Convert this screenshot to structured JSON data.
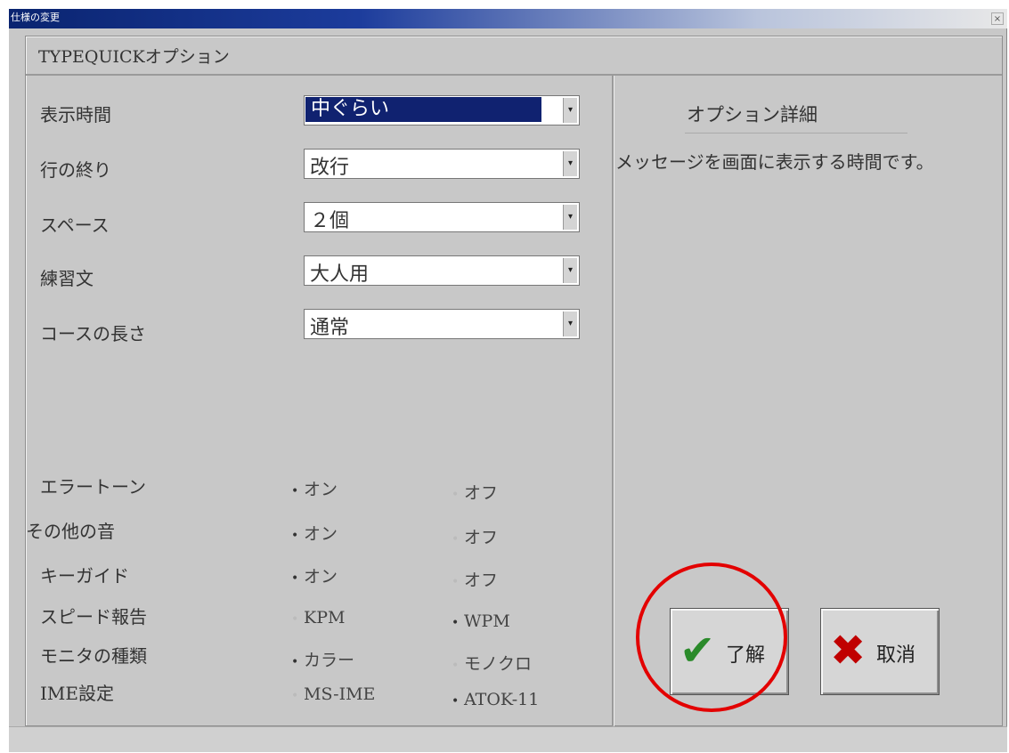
{
  "window": {
    "title": "仕様の変更",
    "close_glyph": "×"
  },
  "group_title": "TYPEQUICKオプション",
  "settings": [
    {
      "label": "表示時間",
      "value": "中ぐらい",
      "selected": true
    },
    {
      "label": "行の終り",
      "value": "改行"
    },
    {
      "label": "スペース",
      "value": "２個"
    },
    {
      "label": "練習文",
      "value": "大人用"
    },
    {
      "label": "コースの長さ",
      "value": "通常"
    }
  ],
  "dropdown_arrow": "▾",
  "toggles": [
    {
      "label": "エラートーン",
      "opt1": "オン",
      "opt2": "オフ",
      "checked": 1
    },
    {
      "label": "その他の音",
      "opt1": "オン",
      "opt2": "オフ",
      "checked": 1
    },
    {
      "label": "キーガイド",
      "opt1": "オン",
      "opt2": "オフ",
      "checked": 1
    },
    {
      "label": "スピード報告",
      "opt1": "KPM",
      "opt2": "WPM",
      "checked": 2
    },
    {
      "label": "モニタの種類",
      "opt1": "カラー",
      "opt2": "モノクロ",
      "checked": 1
    },
    {
      "label": "IME設定",
      "opt1": "MS-IME",
      "opt2": "ATOK-11",
      "checked": 2
    }
  ],
  "radio_dot": "•",
  "detail": {
    "title": "オプション詳細",
    "text": "メッセージを画面に表示する時間です。"
  },
  "buttons": {
    "ok_label": "了解",
    "ok_icon": "✔",
    "cancel_label": "取消",
    "cancel_icon": "✖"
  },
  "colors": {
    "selection": "#102270",
    "ok_check": "#2a8a2a",
    "cancel_x": "#c00000",
    "highlight_circle": "#e30000"
  }
}
